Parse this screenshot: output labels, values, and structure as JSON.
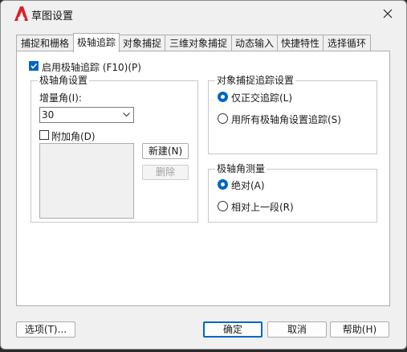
{
  "window": {
    "title": "草图设置",
    "colors": {
      "accent": "#0067c0",
      "logo": "#d8232a"
    }
  },
  "tabs": [
    {
      "label": "捕捉和栅格",
      "active": false
    },
    {
      "label": "极轴追踪",
      "active": true
    },
    {
      "label": "对象捕捉",
      "active": false
    },
    {
      "label": "三维对象捕捉",
      "active": false
    },
    {
      "label": "动态输入",
      "active": false
    },
    {
      "label": "快捷特性",
      "active": false
    },
    {
      "label": "选择循环",
      "active": false
    }
  ],
  "polar": {
    "enable_label": "启用极轴追踪 (F10)(P)",
    "enable_checked": true,
    "angle_settings": {
      "title": "极轴角设置",
      "increment_label": "增量角(I):",
      "increment_value": "30",
      "additional_label": "附加角(D)",
      "additional_checked": false,
      "new_button": "新建(N)",
      "delete_button": "删除"
    },
    "snap_tracking": {
      "title": "对象捕捉追踪设置",
      "options": [
        {
          "label": "仅正交追踪(L)",
          "checked": true
        },
        {
          "label": "用所有极轴角设置追踪(S)",
          "checked": false
        }
      ]
    },
    "measurement": {
      "title": "极轴角测量",
      "options": [
        {
          "label": "绝对(A)",
          "checked": true
        },
        {
          "label": "相对上一段(R)",
          "checked": false
        }
      ]
    }
  },
  "footer": {
    "options_button": "选项(T)...",
    "ok_button": "确定",
    "cancel_button": "取消",
    "help_button": "帮助(H)"
  }
}
